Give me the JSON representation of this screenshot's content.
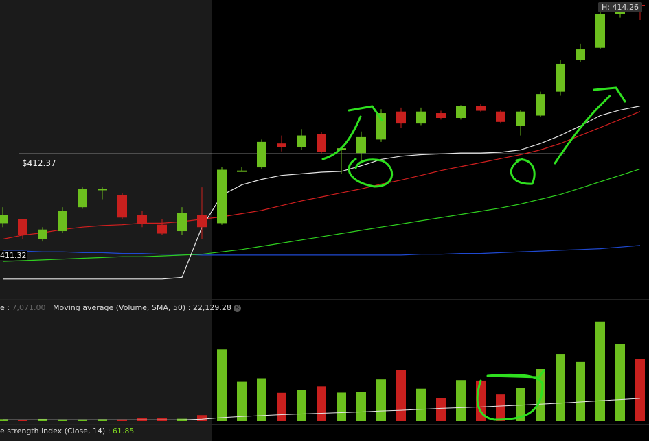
{
  "chart_data": [
    {
      "type": "candlestick",
      "high_label": "H: 414.26",
      "reference_line_label": "$412.37",
      "reference_line_value": 412.37,
      "left_price_label": "411.32",
      "series_colors": {
        "up": "#6cbf1e",
        "down": "#c8201e",
        "white_ma": "#e6e6e6",
        "red_ma": "#d11f1f",
        "green_ma": "#2fcf1f",
        "blue_ma": "#1f49d1"
      },
      "candles": [
        {
          "o": 411.5,
          "h": 411.7,
          "l": 411.45,
          "c": 411.6
        },
        {
          "o": 411.55,
          "h": 411.55,
          "l": 411.3,
          "c": 411.35
        },
        {
          "o": 411.3,
          "h": 411.45,
          "l": 411.27,
          "c": 411.42
        },
        {
          "o": 411.4,
          "h": 411.7,
          "l": 411.38,
          "c": 411.65
        },
        {
          "o": 411.7,
          "h": 411.95,
          "l": 411.68,
          "c": 411.93
        },
        {
          "o": 411.92,
          "h": 411.95,
          "l": 411.8,
          "c": 411.93
        },
        {
          "o": 411.85,
          "h": 411.88,
          "l": 411.55,
          "c": 411.57
        },
        {
          "o": 411.6,
          "h": 411.65,
          "l": 411.45,
          "c": 411.5
        },
        {
          "o": 411.48,
          "h": 411.55,
          "l": 411.35,
          "c": 411.37
        },
        {
          "o": 411.4,
          "h": 411.7,
          "l": 411.35,
          "c": 411.63
        },
        {
          "o": 411.6,
          "h": 411.95,
          "l": 411.3,
          "c": 411.45
        },
        {
          "o": 411.5,
          "h": 412.2,
          "l": 411.48,
          "c": 412.17
        },
        {
          "o": 412.15,
          "h": 412.2,
          "l": 412.15,
          "c": 412.16
        },
        {
          "o": 412.2,
          "h": 412.55,
          "l": 412.18,
          "c": 412.52
        },
        {
          "o": 412.5,
          "h": 412.6,
          "l": 412.4,
          "c": 412.45
        },
        {
          "o": 412.45,
          "h": 412.68,
          "l": 412.42,
          "c": 412.6
        },
        {
          "o": 412.62,
          "h": 412.64,
          "l": 412.37,
          "c": 412.39
        },
        {
          "o": 412.42,
          "h": 412.45,
          "l": 412.12,
          "c": 412.44
        },
        {
          "o": 412.38,
          "h": 412.65,
          "l": 412.25,
          "c": 412.58
        },
        {
          "o": 412.55,
          "h": 412.93,
          "l": 412.52,
          "c": 412.88
        },
        {
          "o": 412.9,
          "h": 412.95,
          "l": 412.7,
          "c": 412.75
        },
        {
          "o": 412.75,
          "h": 412.95,
          "l": 412.73,
          "c": 412.9
        },
        {
          "o": 412.88,
          "h": 412.91,
          "l": 412.8,
          "c": 412.82
        },
        {
          "o": 412.82,
          "h": 412.98,
          "l": 412.8,
          "c": 412.97
        },
        {
          "o": 412.97,
          "h": 413.0,
          "l": 412.9,
          "c": 412.91
        },
        {
          "o": 412.9,
          "h": 412.92,
          "l": 412.75,
          "c": 412.77
        },
        {
          "o": 412.72,
          "h": 412.92,
          "l": 412.6,
          "c": 412.9
        },
        {
          "o": 412.85,
          "h": 413.15,
          "l": 412.83,
          "c": 413.12
        },
        {
          "o": 413.15,
          "h": 413.55,
          "l": 413.1,
          "c": 413.5
        },
        {
          "o": 413.55,
          "h": 413.75,
          "l": 413.52,
          "c": 413.68
        },
        {
          "o": 413.7,
          "h": 414.18,
          "l": 413.68,
          "c": 414.12
        },
        {
          "o": 414.12,
          "h": 414.26,
          "l": 414.08,
          "c": 414.23
        },
        {
          "o": 414.24,
          "h": 414.25,
          "l": 414.05,
          "c": 414.23
        }
      ],
      "moving_averages": {
        "white": [
          410.8,
          410.8,
          410.8,
          410.8,
          410.8,
          410.8,
          410.8,
          410.8,
          410.8,
          410.82,
          411.45,
          411.85,
          411.98,
          412.05,
          412.1,
          412.12,
          412.14,
          412.15,
          412.22,
          412.3,
          412.34,
          412.36,
          412.37,
          412.38,
          412.38,
          412.39,
          412.42,
          412.5,
          412.6,
          412.72,
          412.85,
          412.92,
          412.97
        ],
        "red": [
          411.3,
          411.35,
          411.38,
          411.42,
          411.45,
          411.47,
          411.48,
          411.5,
          411.5,
          411.52,
          411.55,
          411.58,
          411.62,
          411.66,
          411.72,
          411.78,
          411.83,
          411.88,
          411.93,
          411.99,
          412.04,
          412.1,
          412.16,
          412.21,
          412.26,
          412.31,
          412.36,
          412.42,
          412.5,
          412.6,
          412.7,
          412.8,
          412.9
        ],
        "green": [
          411.02,
          411.03,
          411.04,
          411.05,
          411.06,
          411.07,
          411.08,
          411.08,
          411.09,
          411.1,
          411.11,
          411.14,
          411.17,
          411.21,
          411.25,
          411.29,
          411.33,
          411.37,
          411.41,
          411.45,
          411.49,
          411.53,
          411.57,
          411.61,
          411.65,
          411.69,
          411.74,
          411.8,
          411.86,
          411.94,
          412.02,
          412.1,
          412.18
        ],
        "blue": [
          411.15,
          411.15,
          411.14,
          411.14,
          411.13,
          411.13,
          411.12,
          411.12,
          411.11,
          411.11,
          411.1,
          411.1,
          411.1,
          411.1,
          411.1,
          411.1,
          411.1,
          411.1,
          411.1,
          411.1,
          411.1,
          411.11,
          411.11,
          411.12,
          411.12,
          411.13,
          411.14,
          411.15,
          411.16,
          411.17,
          411.18,
          411.2,
          411.22
        ]
      },
      "ylim": [
        410.6,
        414.3
      ]
    },
    {
      "type": "bar",
      "legend_prefix": "e",
      "legend_value": "7,071.00",
      "legend_ma_text": "Moving average (Volume, SMA, 50) : 22,129.28",
      "volumes": [
        800,
        600,
        900,
        700,
        700,
        800,
        700,
        1300,
        1200,
        1000,
        2600,
        31000,
        17000,
        18500,
        12200,
        13500,
        15000,
        12300,
        12700,
        18000,
        22200,
        14000,
        9800,
        17700,
        17500,
        11500,
        14300,
        22500,
        29000,
        25500,
        43000,
        33400,
        26700
      ],
      "volume_up": [
        true,
        false,
        true,
        true,
        true,
        true,
        false,
        false,
        false,
        true,
        false,
        true,
        true,
        true,
        false,
        true,
        false,
        true,
        true,
        true,
        false,
        true,
        false,
        true,
        false,
        false,
        true,
        true,
        true,
        true,
        true,
        true,
        false
      ],
      "ma_values": [
        500,
        500,
        500,
        500,
        500,
        500,
        500,
        500,
        500,
        500,
        800,
        1500,
        2000,
        2400,
        2800,
        3100,
        3400,
        3700,
        4000,
        4400,
        4700,
        5100,
        5500,
        5800,
        6100,
        6500,
        6900,
        7300,
        7800,
        8300,
        8800,
        9300,
        9800
      ],
      "ylim": [
        0,
        45000
      ]
    }
  ],
  "rsi": {
    "prefix": "e strength index (Close, 14) : ",
    "value": "61.85"
  },
  "background": {
    "shaded_left": "#1b1b1b",
    "main": "#000000"
  }
}
